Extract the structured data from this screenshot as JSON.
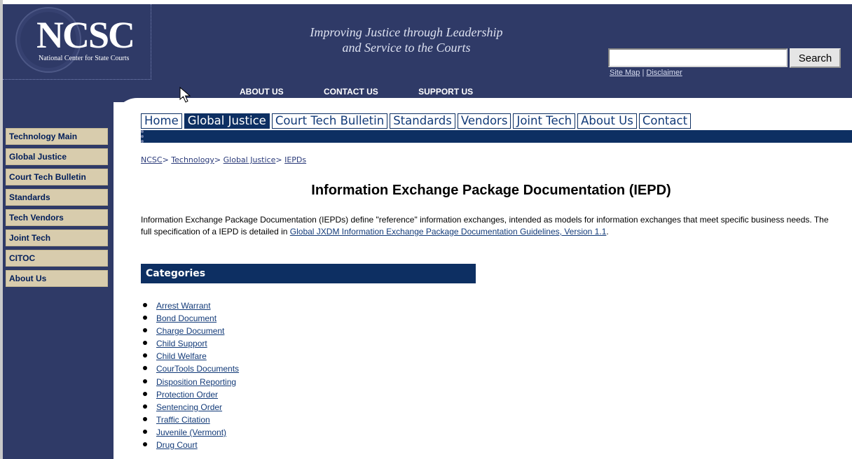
{
  "header": {
    "logo": "NCSC",
    "logo_subtitle": "National Center for State Courts",
    "tagline": "Improving Justice through Leadership\nand Service to the Courts",
    "search": {
      "value": "",
      "placeholder": "",
      "button_label": "Search"
    },
    "utility_links": {
      "site_map": "Site Map",
      "separator": "|",
      "disclaimer": "Disclaimer"
    },
    "top_nav": [
      "ABOUT US",
      "CONTACT US",
      "SUPPORT US"
    ]
  },
  "sidebar": {
    "items": [
      "Technology Main",
      "Global Justice",
      "Court Tech Bulletin",
      "Standards",
      "Tech Vendors",
      "Joint Tech",
      "CITOC",
      "About Us"
    ]
  },
  "tabs": {
    "items": [
      "Home",
      "Global Justice",
      "Court Tech Bulletin",
      "Standards",
      "Vendors",
      "Joint Tech",
      "About Us",
      "Contact"
    ],
    "active": "Global Justice"
  },
  "breadcrumb": {
    "items": [
      "NCSC",
      "Technology",
      "Global Justice",
      "IEPDs"
    ],
    "separator": ">"
  },
  "page": {
    "title": "Information Exchange Package Documentation (IEPD)",
    "description_before": "Information Exchange Package Documentation (IEPDs) define \"reference\" information exchanges, intended as models for information exchanges that meet specific business needs. The full specification of a IEPD is detailed in ",
    "description_link": "Global JXDM Information Exchange Package Documentation Guidelines, Version 1.1",
    "description_after": "."
  },
  "categories": {
    "header": "Categories",
    "items": [
      "Arrest Warrant",
      "Bond Document",
      "Charge Document",
      "Child Support",
      "Child Welfare",
      "CourTools Documents",
      "Disposition Reporting",
      "Protection Order",
      "Sentencing Order",
      "Traffic Citation",
      "Juvenile (Vermont)",
      "Drug Court"
    ]
  },
  "colors": {
    "header_background": "#2f3a67",
    "sidebar_button": "#d8ccad",
    "navy": "#0d2f62",
    "link": "#123a78"
  }
}
